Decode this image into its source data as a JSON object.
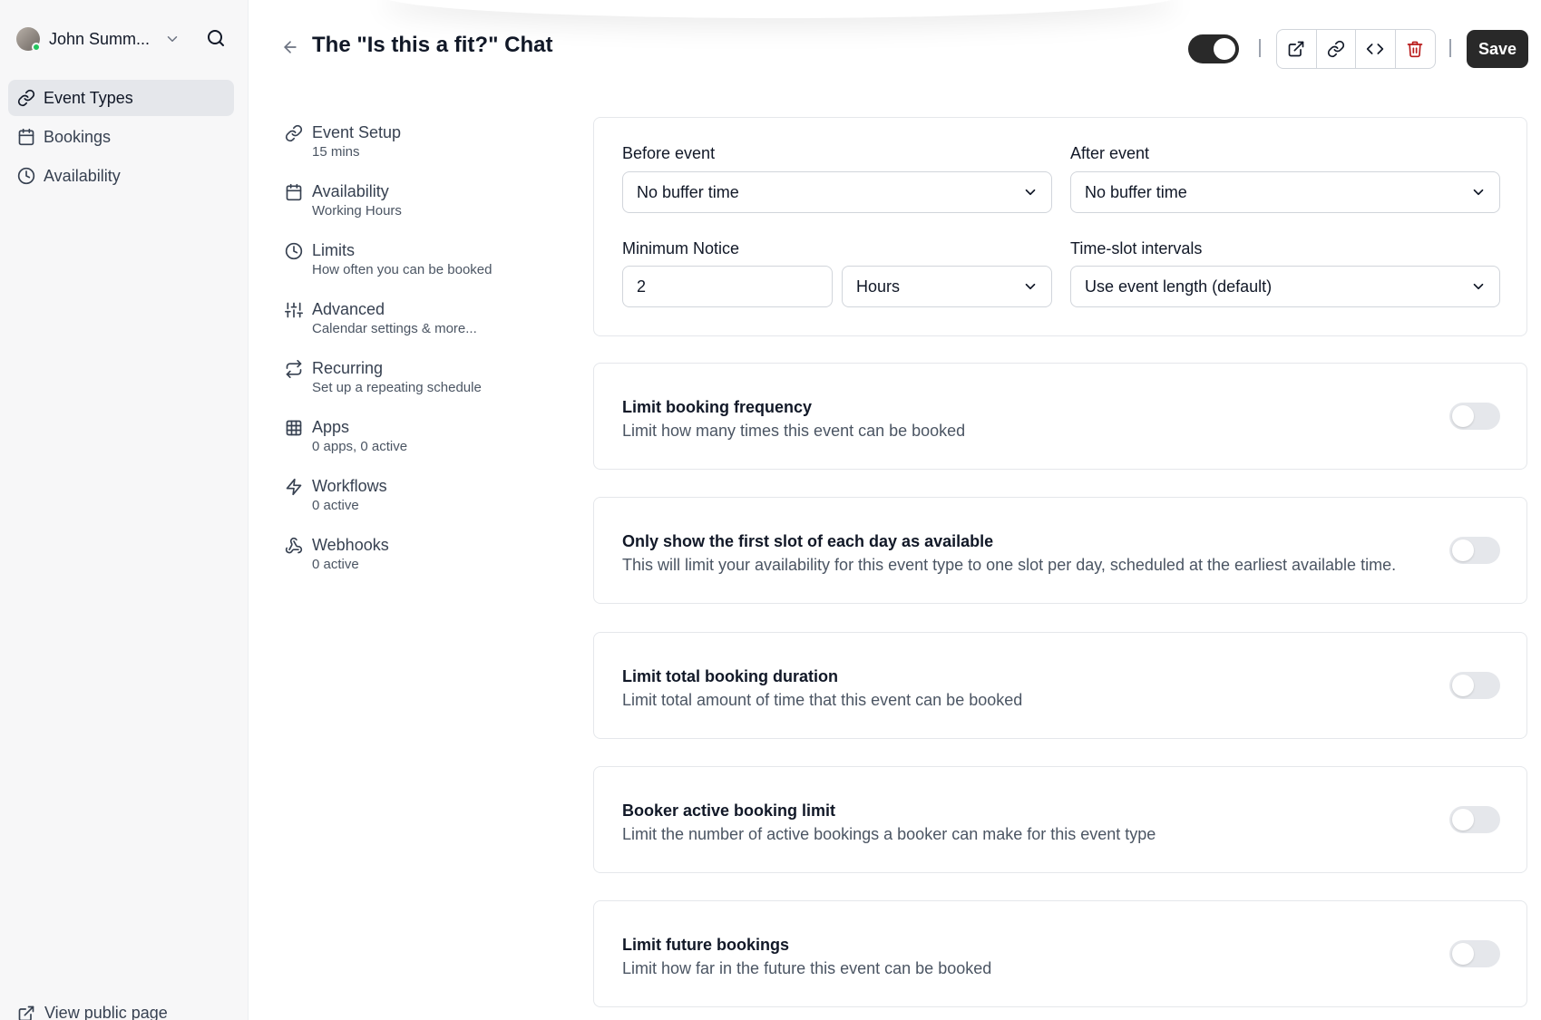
{
  "sidebar": {
    "user_name": "John Summ...",
    "items": [
      {
        "label": "Event Types",
        "icon": "link-icon",
        "active": true
      },
      {
        "label": "Bookings",
        "icon": "calendar-icon",
        "active": false
      },
      {
        "label": "Availability",
        "icon": "clock-icon",
        "active": false
      }
    ],
    "view_public_page": "View public page"
  },
  "header": {
    "title": "The \"Is this a fit?\" Chat",
    "save_label": "Save",
    "hidden_toggle_on": true
  },
  "settings_nav": [
    {
      "title": "Event Setup",
      "subtitle": "15 mins",
      "icon": "link-icon"
    },
    {
      "title": "Availability",
      "subtitle": "Working Hours",
      "icon": "calendar-icon"
    },
    {
      "title": "Limits",
      "subtitle": "How often you can be booked",
      "icon": "clock-icon"
    },
    {
      "title": "Advanced",
      "subtitle": "Calendar settings & more...",
      "icon": "sliders-icon"
    },
    {
      "title": "Recurring",
      "subtitle": "Set up a repeating schedule",
      "icon": "repeat-icon"
    },
    {
      "title": "Apps",
      "subtitle": "0 apps, 0 active",
      "icon": "grid-icon"
    },
    {
      "title": "Workflows",
      "subtitle": "0 active",
      "icon": "zap-icon"
    },
    {
      "title": "Webhooks",
      "subtitle": "0 active",
      "icon": "webhook-icon"
    }
  ],
  "buffers": {
    "before_label": "Before event",
    "before_value": "No buffer time",
    "after_label": "After event",
    "after_value": "No buffer time",
    "notice_label": "Minimum Notice",
    "notice_value": "2",
    "notice_unit": "Hours",
    "interval_label": "Time-slot intervals",
    "interval_value": "Use event length (default)"
  },
  "limits": [
    {
      "title": "Limit booking frequency",
      "description": "Limit how many times this event can be booked",
      "enabled": false
    },
    {
      "title": "Only show the first slot of each day as available",
      "description": "This will limit your availability for this event type to one slot per day, scheduled at the earliest available time.",
      "enabled": false
    },
    {
      "title": "Limit total booking duration",
      "description": "Limit total amount of time that this event can be booked",
      "enabled": false
    },
    {
      "title": "Booker active booking limit",
      "description": "Limit the number of active bookings a booker can make for this event type",
      "enabled": false
    },
    {
      "title": "Limit future bookings",
      "description": "Limit how far in the future this event can be booked",
      "enabled": false
    }
  ]
}
